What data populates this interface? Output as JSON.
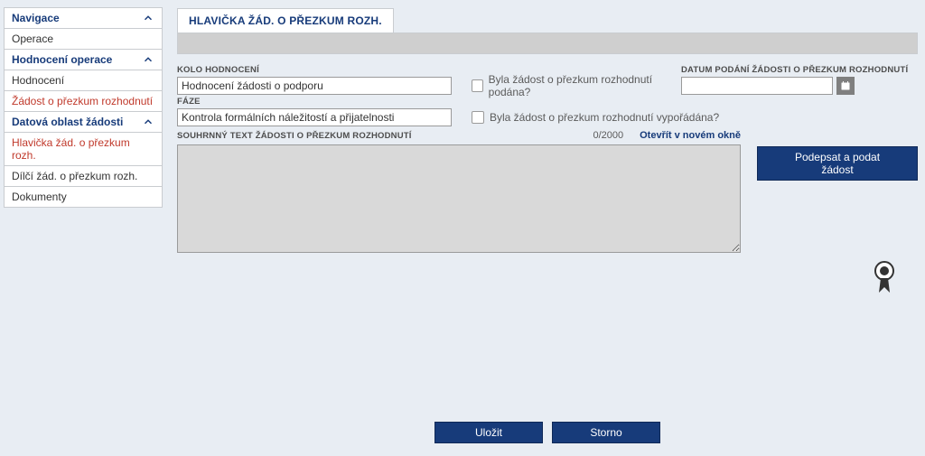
{
  "sidebar": {
    "nav_header": "Navigace",
    "nav_items": [
      "Operace"
    ],
    "eval_header": "Hodnocení operace",
    "eval_items": [
      "Hodnocení",
      "Žádost o přezkum rozhodnutí"
    ],
    "data_header": "Datová oblast žádosti",
    "data_items": [
      "Hlavička žád. o přezkum rozh.",
      "Dílčí žád. o přezkum rozh.",
      "Dokumenty"
    ]
  },
  "header": {
    "tab_title": "HLAVIČKA ŽÁD. O PŘEZKUM ROZH."
  },
  "form": {
    "kolo_label": "KOLO HODNOCENÍ",
    "kolo_value": "Hodnocení žádosti o podporu",
    "faze_label": "FÁZE",
    "faze_value": "Kontrola formálních náležitostí a přijatelnosti",
    "chk1_label": "Byla žádost o přezkum rozhodnutí podána?",
    "chk2_label": "Byla žádost o přezkum rozhodnutí vypořádána?",
    "date_label": "DATUM PODÁNÍ ŽÁDOSTI O PŘEZKUM ROZHODNUTÍ",
    "date_value": "",
    "summary_label": "SOUHRNNÝ TEXT ŽÁDOSTI O PŘEZKUM ROZHODNUTÍ",
    "summary_counter": "0/2000",
    "summary_open": "Otevřít v novém okně",
    "sign_button": "Podepsat a podat žádost"
  },
  "footer": {
    "save": "Uložit",
    "cancel": "Storno"
  }
}
